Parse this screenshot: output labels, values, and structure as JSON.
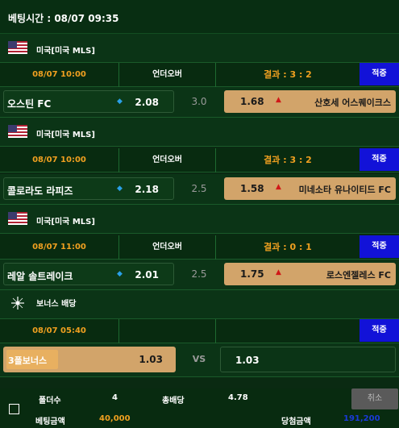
{
  "header": {
    "bet_time": "베팅시간 : 08/07 09:35"
  },
  "icons": {
    "league_flag": "us-flag-icon",
    "bonus": "sparkle-icon",
    "up": "up-arrow-icon",
    "down": "down-arrow-icon"
  },
  "colors": {
    "accent_orange": "#f0a020",
    "hit_blue": "#1212d8",
    "away_tan": "#d2a46a",
    "win_blue": "#1a3ad8"
  },
  "bets": [
    {
      "league": "미국[미국 MLS]",
      "time": "08/07 10:00",
      "kind": "언더오버",
      "result": "결과 : 3 : 2",
      "status": "적중",
      "home": {
        "name": "오스틴 FC",
        "odd": "2.08",
        "arrow": "🔹"
      },
      "line": "3.0",
      "away": {
        "name": "산호세 어스퀘이크스",
        "odd": "1.68",
        "arrow": "↑"
      }
    },
    {
      "league": "미국[미국 MLS]",
      "time": "08/07 10:00",
      "kind": "언더오버",
      "result": "결과 : 3 : 2",
      "status": "적중",
      "home": {
        "name": "콜로라도 라피즈",
        "odd": "2.18",
        "arrow": "🔹"
      },
      "line": "2.5",
      "away": {
        "name": "미네소타 유나이티드 FC",
        "odd": "1.58",
        "arrow": "↑"
      }
    },
    {
      "league": "미국[미국 MLS]",
      "time": "08/07 11:00",
      "kind": "언더오버",
      "result": "결과 : 0 : 1",
      "status": "적중",
      "home": {
        "name": "레알 솔트레이크",
        "odd": "2.01",
        "arrow": "🔹"
      },
      "line": "2.5",
      "away": {
        "name": "로스엔젤레스 FC",
        "odd": "1.75",
        "arrow": "↑"
      }
    }
  ],
  "bonus": {
    "title": "보너스 배당",
    "time": "08/07 05:40",
    "status": "적중",
    "home_name": "3폴보너스",
    "home_odd": "1.03",
    "vs": "VS",
    "away_odd": "1.03"
  },
  "summary": {
    "folders_label": "폴더수",
    "folders_value": "4",
    "total_odds_label": "총배당",
    "total_odds_value": "4.78",
    "bet_amount_label": "베팅금액",
    "bet_amount_value": "40,000",
    "win_amount_label": "당첨금액",
    "win_amount_value": "191,200",
    "cancel_label": "취소"
  }
}
